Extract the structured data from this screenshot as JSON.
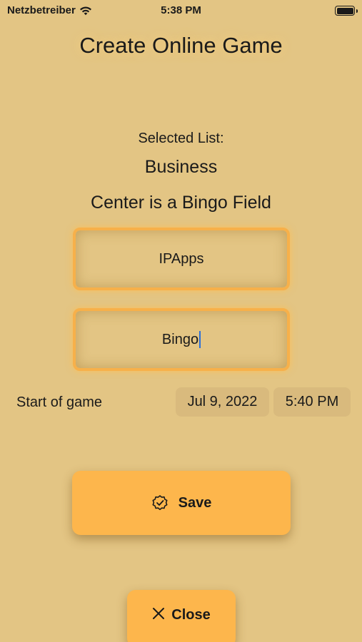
{
  "status_bar": {
    "carrier": "Netzbetreiber",
    "time": "5:38 PM",
    "wifi_icon": "wifi-icon",
    "battery_icon": "battery-icon"
  },
  "header": {
    "title": "Create Online Game"
  },
  "selection": {
    "label": "Selected List:",
    "list_name": "Business",
    "center_info": "Center is a Bingo Field"
  },
  "fields": {
    "host_name": "IPApps",
    "game_name": "Bingo"
  },
  "start": {
    "label": "Start of game",
    "date": "Jul 9, 2022",
    "time": "5:40 PM"
  },
  "actions": {
    "save_label": "Save",
    "save_icon": "checkmark-seal-icon",
    "close_label": "Close",
    "close_icon": "close-icon"
  },
  "colors": {
    "background": "#E3C584",
    "accent": "#FDB64C",
    "field_border": "#F7B04A",
    "cursor": "#2A6FDB"
  }
}
